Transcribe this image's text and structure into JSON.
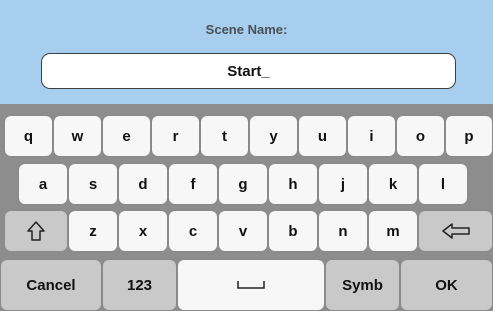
{
  "header": {
    "title": "Scene Name:"
  },
  "field": {
    "value": "Start_"
  },
  "keyboard": {
    "row1": [
      "q",
      "w",
      "e",
      "r",
      "t",
      "y",
      "u",
      "i",
      "o",
      "p"
    ],
    "row2": [
      "a",
      "s",
      "d",
      "f",
      "g",
      "h",
      "j",
      "k",
      "l"
    ],
    "row3": [
      "z",
      "x",
      "c",
      "v",
      "b",
      "n",
      "m"
    ],
    "bottom": {
      "cancel": "Cancel",
      "numbers": "123",
      "symbols": "Symb",
      "ok": "OK"
    },
    "icons": {
      "shift": "shift-arrow-icon",
      "backspace": "backspace-arrow-icon",
      "space": "space-bracket-icon"
    }
  },
  "colors": {
    "header_bg": "#a7cdef",
    "keyboard_bg": "#8d8d8d",
    "key_bg": "#f7f7f7",
    "special_key_bg": "#c9c9c9"
  }
}
